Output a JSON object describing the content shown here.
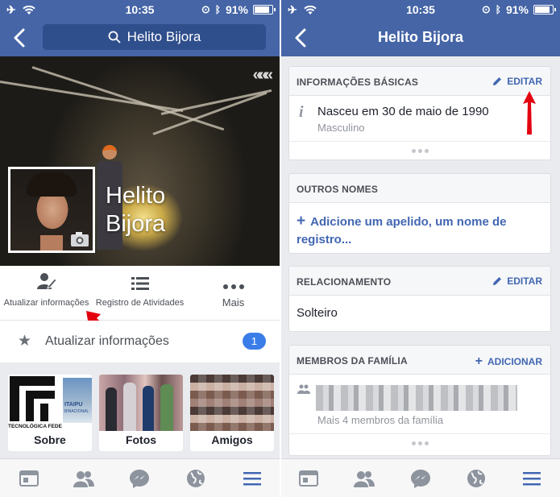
{
  "status_bar": {
    "time": "10:35",
    "battery": "91%"
  },
  "left": {
    "search": {
      "value": "Helito Bijora"
    },
    "cover": {
      "first_name": "Helito",
      "last_name": "Bijora"
    },
    "actions": [
      {
        "label": "Atualizar informações"
      },
      {
        "label": "Registro de Atividades"
      },
      {
        "label": "Mais"
      }
    ],
    "update_row": {
      "label": "Atualizar informações",
      "badge": "1"
    },
    "cards": [
      {
        "label": "Sobre",
        "thumb_text_1": "TECNOLÓGICA FEDE",
        "thumb_text_2": "ITAIPU",
        "thumb_text_3": "BINACIONAL"
      },
      {
        "label": "Fotos"
      },
      {
        "label": "Amigos"
      }
    ]
  },
  "right": {
    "title": "Helito Bijora",
    "basic_info": {
      "header": "INFORMAÇÕES BÁSICAS",
      "edit": "EDITAR",
      "birth": "Nasceu em 30 de maio de 1990",
      "gender": "Masculino"
    },
    "other_names": {
      "header": "OUTROS NOMES",
      "add_line1": "Adicione um apelido, um nome de",
      "add_line2": "registro..."
    },
    "relationship": {
      "header": "RELACIONAMENTO",
      "edit": "EDITAR",
      "value": "Solteiro"
    },
    "family": {
      "header": "MEMBROS DA FAMÍLIA",
      "add": "ADICIONAR",
      "more": "Mais 4 membros da família"
    }
  },
  "colors": {
    "nav_blue": "#4565a6",
    "link_blue": "#4267b2",
    "badge_blue": "#3b7de8",
    "annotation_red": "#e3000f"
  }
}
